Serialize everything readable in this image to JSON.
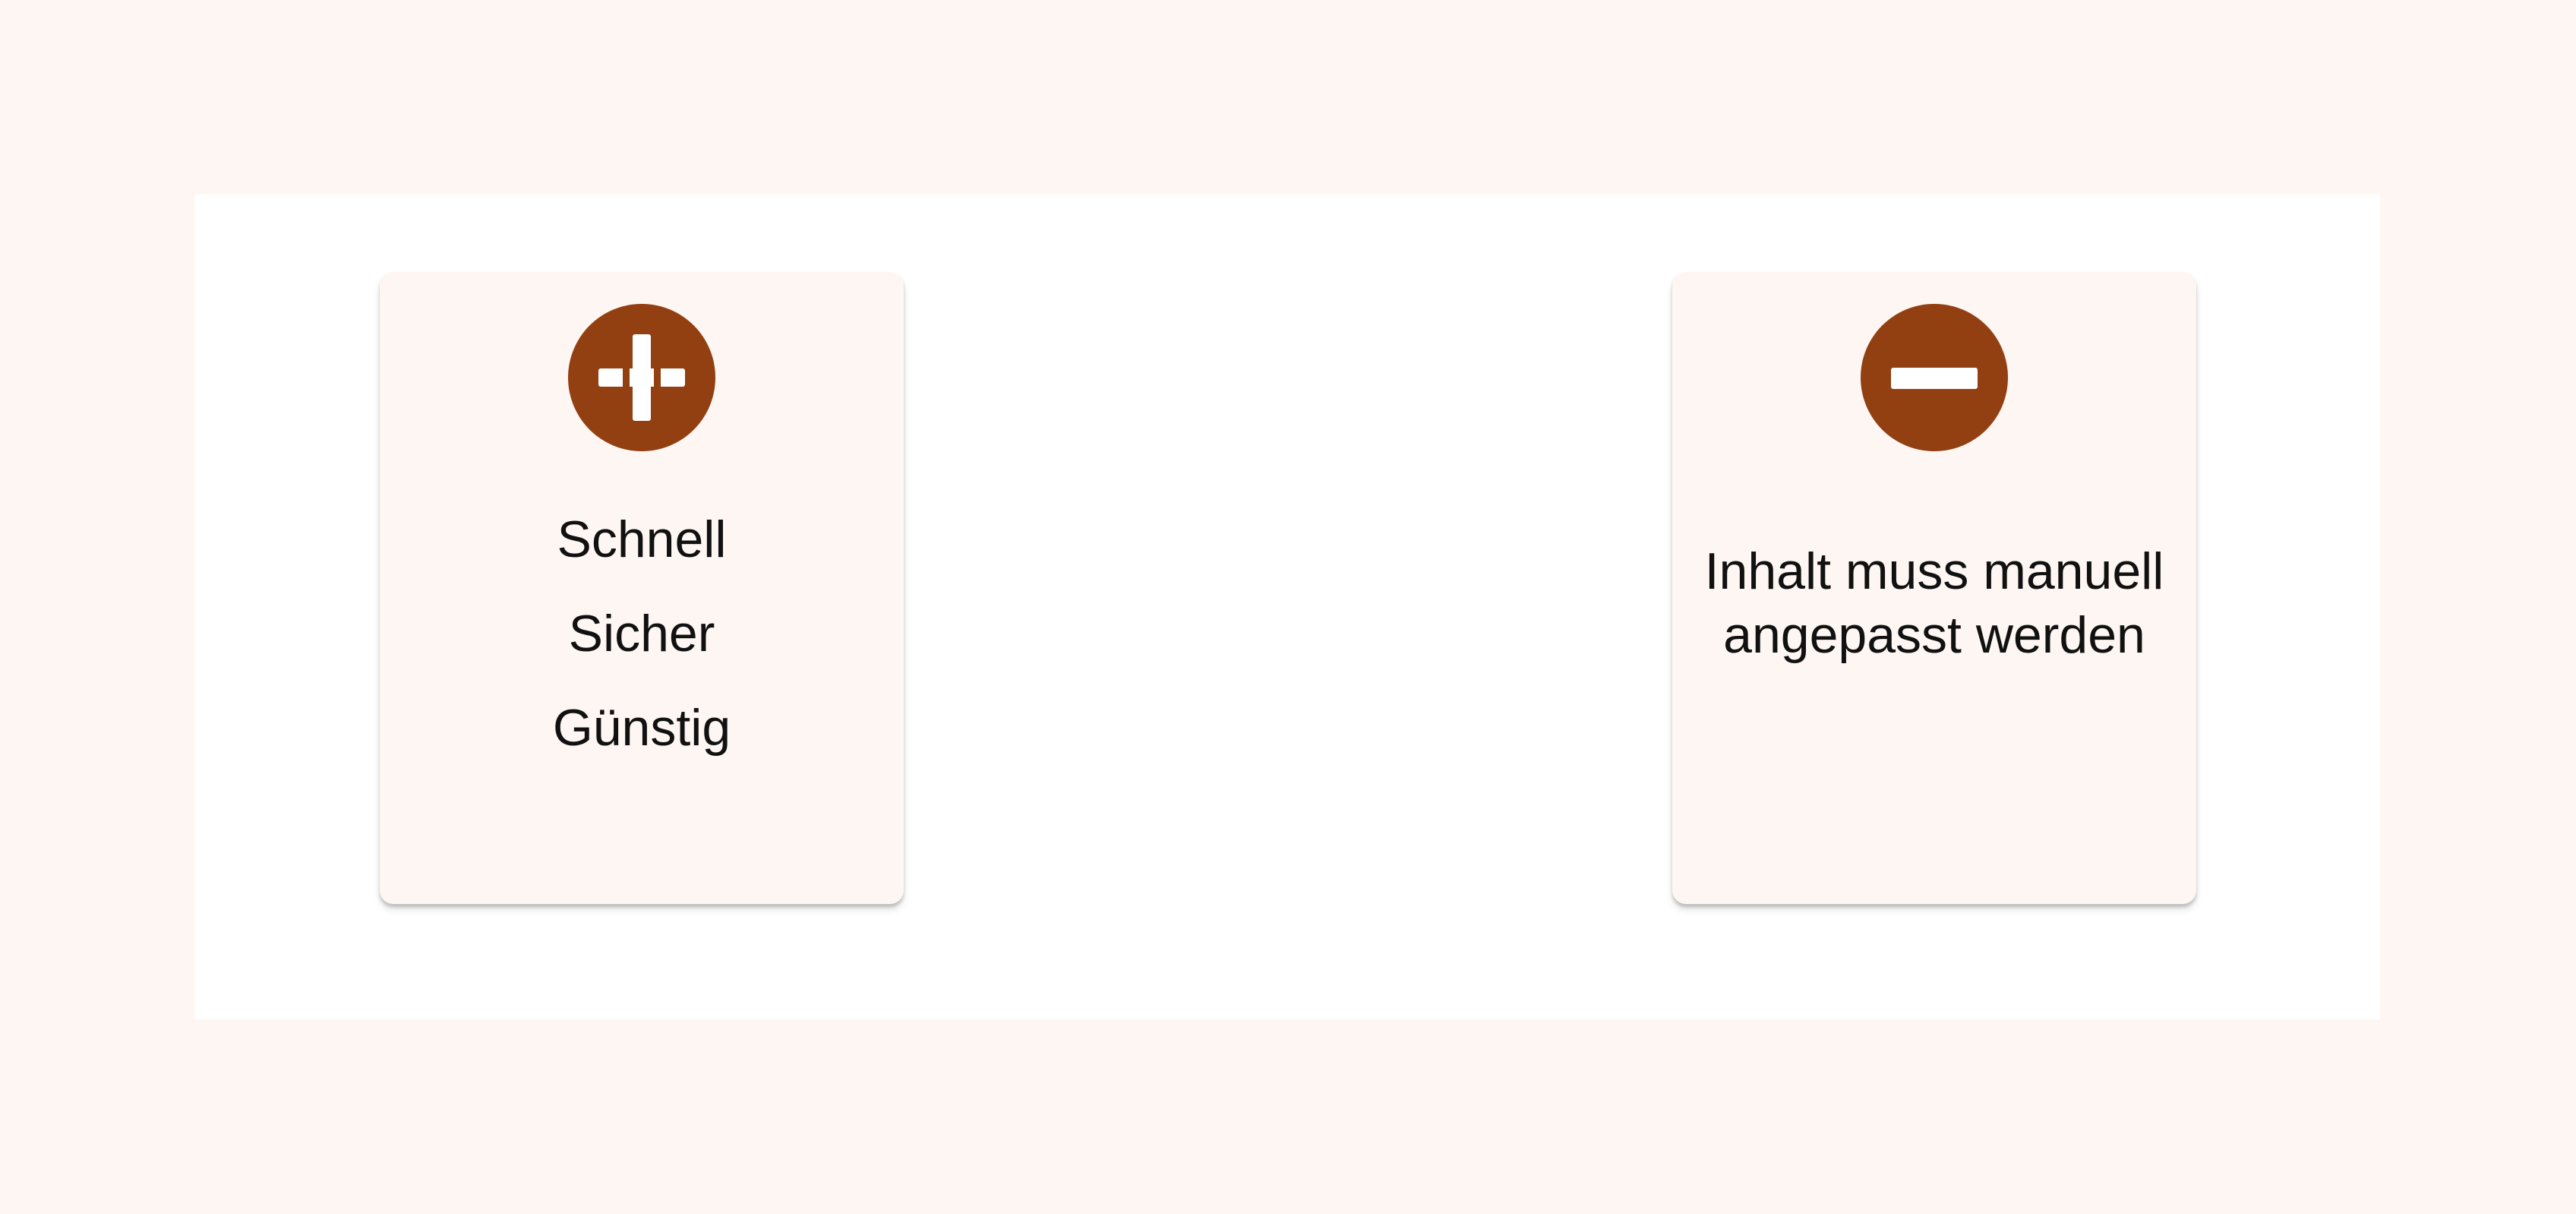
{
  "pros": {
    "icon": "plus-circle-icon",
    "items": [
      "Schnell",
      "Sicher",
      "Günstig"
    ]
  },
  "cons": {
    "icon": "minus-circle-icon",
    "lines": [
      "Inhalt muss manuell",
      "angepasst werden"
    ]
  },
  "colors": {
    "background": "#fef6f2",
    "panel": "#ffffff",
    "card": "#fef6f2",
    "icon": "#923f12",
    "text": "#111111"
  }
}
